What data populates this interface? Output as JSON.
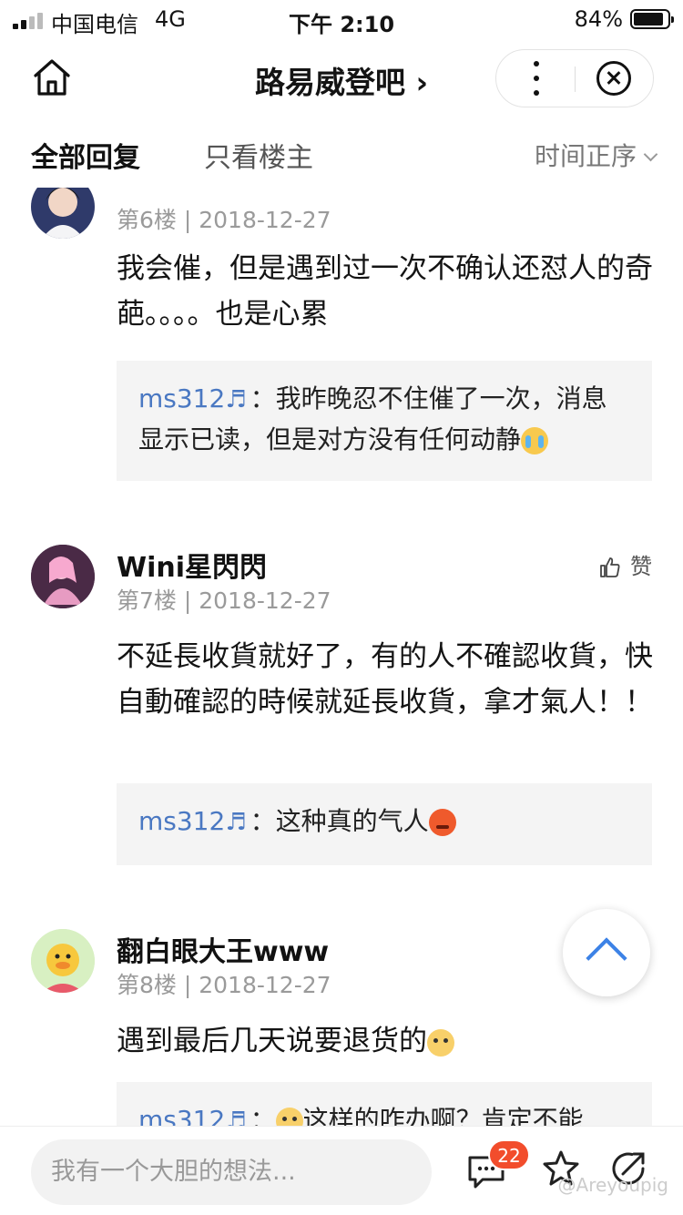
{
  "status_bar": {
    "carrier": "中国电信",
    "network": "4G",
    "time": "下午 2:10",
    "battery": "84%"
  },
  "nav": {
    "title": "路易威登吧",
    "title_chevron": "›"
  },
  "tabs": {
    "all": "全部回复",
    "owner_only": "只看楼主",
    "sort": "时间正序"
  },
  "posts": [
    {
      "floor": "第6楼",
      "date": "2018-12-27",
      "content": "我会催，但是遇到过一次不确认还怼人的奇葩。。。。也是心累",
      "reply": {
        "user": "ms312",
        "separator": "：",
        "text": "我昨晚忍不住催了一次，消息显示已读，但是对方没有任何动静",
        "emoji": "cry-emoji"
      }
    },
    {
      "username": "Wini星閃閃",
      "floor": "第7楼",
      "date": "2018-12-27",
      "like": "赞",
      "content": "不延長收貨就好了，有的人不確認收貨，快自動確認的時候就延長收貨，拿才氣人！！",
      "reply": {
        "user": "ms312",
        "separator": "：",
        "text": "这种真的气人",
        "emoji": "angry-emoji"
      }
    },
    {
      "username": "翻白眼大王www",
      "floor": "第8楼",
      "date": "2018-12-27",
      "content": "遇到最后几天说要退货的",
      "content_emoji": "pleading-emoji",
      "reply": {
        "user": "ms312",
        "separator": "：",
        "text": "这样的咋办啊？肯定不能",
        "emoji": "thinking-emoji"
      }
    }
  ],
  "bottom": {
    "placeholder": "我有一个大胆的想法...",
    "comment_count": "22",
    "watermark": "@Areyoupig"
  },
  "colors": {
    "reply_user": "#4a78c2",
    "badge": "#f24d2c",
    "scroll_top": "#3c82e6"
  }
}
